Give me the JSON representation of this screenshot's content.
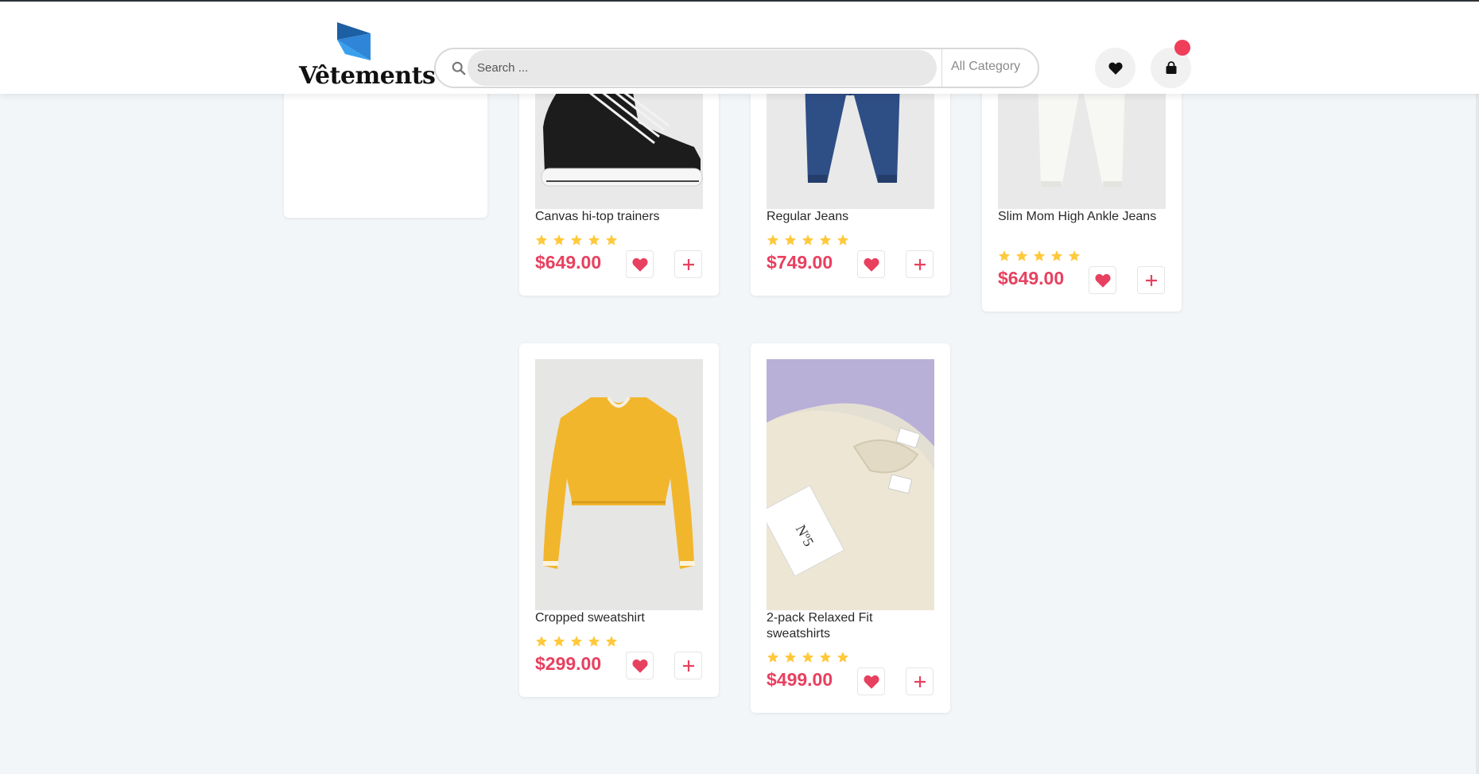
{
  "header": {
    "logo_text": "Vêtements",
    "search_placeholder": "Search ...",
    "category_label": "All Category"
  },
  "colors": {
    "accent": "#e8405f",
    "star": "#ffc93c",
    "background": "#f3f6f9"
  },
  "products": [
    {
      "name": "Canvas hi-top trainers",
      "price": "$649.00",
      "rating": 5
    },
    {
      "name": "Regular Jeans",
      "price": "$749.00",
      "rating": 5
    },
    {
      "name": "Slim Mom High Ankle Jeans",
      "price": "$649.00",
      "rating": 5
    },
    {
      "name": "Cropped sweatshirt",
      "price": "$299.00",
      "rating": 5
    },
    {
      "name": "2-pack Relaxed Fit sweatshirts",
      "price": "$499.00",
      "rating": 5
    }
  ]
}
